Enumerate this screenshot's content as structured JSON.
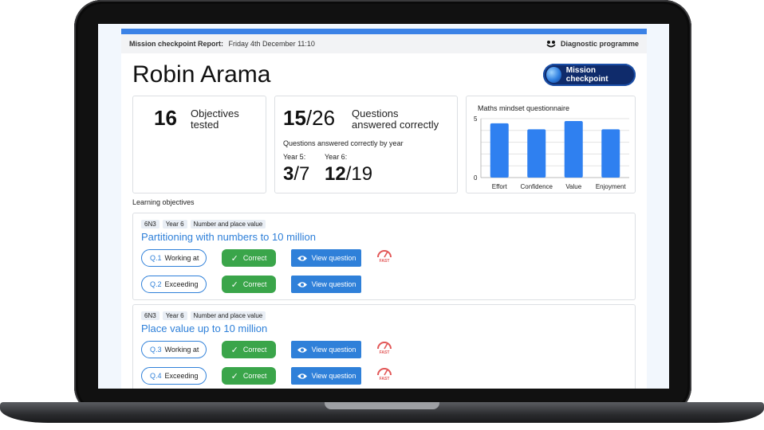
{
  "report": {
    "label": "Mission checkpoint Report:",
    "date": "Friday 4th December 11:10",
    "brand": "Diagnostic programme"
  },
  "student": {
    "name": "Robin Arama"
  },
  "badge": {
    "label": "Mission checkpoint"
  },
  "objectives_card": {
    "count": "16",
    "label_line1": "Objectives",
    "label_line2": "tested"
  },
  "questions_card": {
    "correct": "15",
    "total": "/26",
    "label_line1": "Questions",
    "label_line2": "answered correctly",
    "by_year_label": "Questions answered correctly by year",
    "year5": {
      "label": "Year 5:",
      "correct": "3",
      "total": "/7"
    },
    "year6": {
      "label": "Year 6:",
      "correct": "12",
      "total": "/19"
    }
  },
  "chart_data": {
    "type": "bar",
    "title": "Maths mindset questionnaire",
    "categories": [
      "Effort",
      "Confidence",
      "Value",
      "Enjoyment"
    ],
    "values": [
      4.6,
      4.1,
      4.8,
      4.1
    ],
    "ylim": [
      0,
      5
    ],
    "yticks": [
      "5",
      "0"
    ],
    "grid": true,
    "color": "#2f80f0"
  },
  "learning_objectives": {
    "title": "Learning objectives",
    "items": [
      {
        "tags": [
          "6N3",
          "Year 6",
          "Number and place value"
        ],
        "title": "Partitioning with numbers to 10 million",
        "questions": [
          {
            "num": "Q.1",
            "level": "Working at",
            "result": "Correct",
            "view": "View question",
            "fast": true,
            "fast_label": "FAST"
          },
          {
            "num": "Q.2",
            "level": "Exceeding",
            "result": "Correct",
            "view": "View question",
            "fast": false,
            "fast_label": ""
          }
        ]
      },
      {
        "tags": [
          "6N3",
          "Year 6",
          "Number and place value"
        ],
        "title": "Place value up to 10 million",
        "questions": [
          {
            "num": "Q.3",
            "level": "Working at",
            "result": "Correct",
            "view": "View question",
            "fast": true,
            "fast_label": "FAST"
          },
          {
            "num": "Q.4",
            "level": "Exceeding",
            "result": "Correct",
            "view": "View question",
            "fast": true,
            "fast_label": "FAST"
          }
        ]
      }
    ]
  },
  "colors": {
    "accent": "#2f80d9",
    "success": "#3aa54a",
    "navy": "#0f2b6b",
    "fast": "#e25656"
  }
}
